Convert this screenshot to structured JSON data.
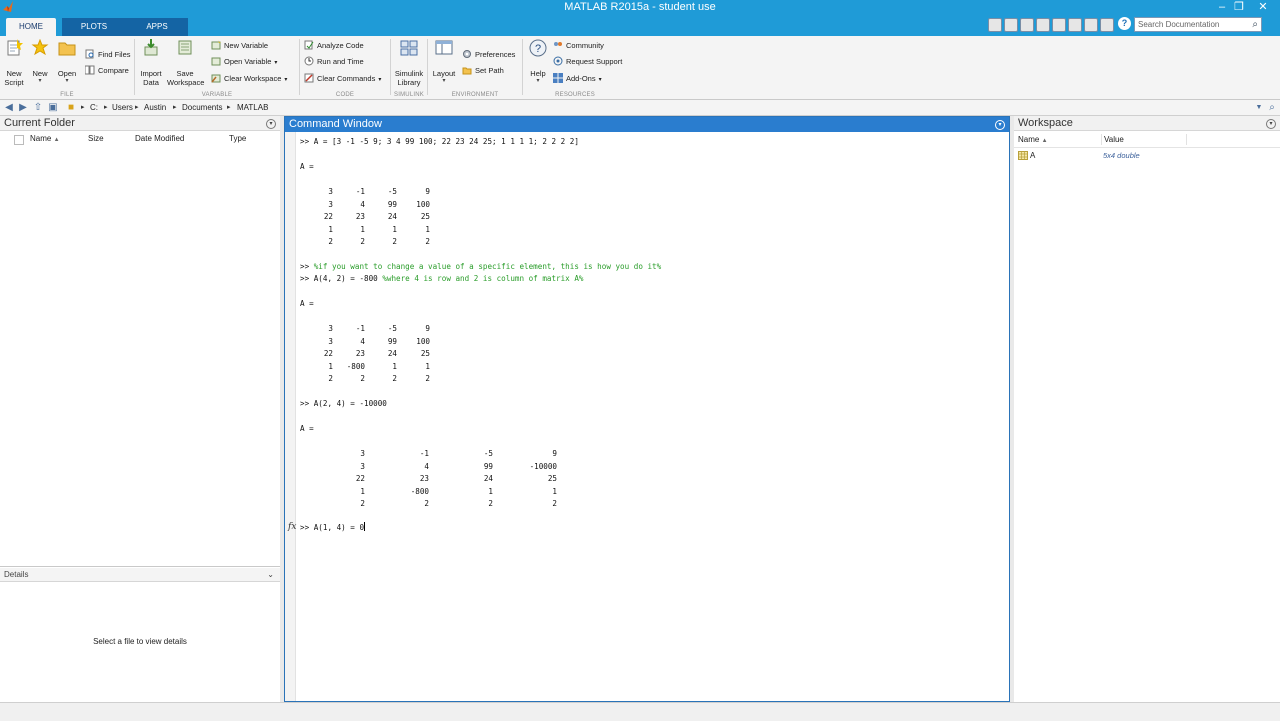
{
  "window": {
    "title": "MATLAB R2015a - student use",
    "controls": {
      "minimize": "–",
      "restore": "❐",
      "close": "✕"
    }
  },
  "tabs": [
    {
      "label": "HOME",
      "active": true
    },
    {
      "label": "PLOTS",
      "active": false
    },
    {
      "label": "APPS",
      "active": false
    }
  ],
  "search": {
    "placeholder": "Search Documentation"
  },
  "ribbon": {
    "file": {
      "group_label": "FILE",
      "new_script": "New\nScript",
      "new": "New",
      "open": "Open",
      "find_files": "Find Files",
      "compare": "Compare"
    },
    "variable": {
      "group_label": "VARIABLE",
      "import_data": "Import\nData",
      "save_workspace": "Save\nWorkspace",
      "new_variable": "New Variable",
      "open_variable": "Open Variable",
      "clear_workspace": "Clear Workspace"
    },
    "code": {
      "group_label": "CODE",
      "analyze_code": "Analyze Code",
      "run_and_time": "Run and Time",
      "clear_commands": "Clear Commands"
    },
    "simulink": {
      "group_label": "SIMULINK",
      "simulink_library": "Simulink\nLibrary"
    },
    "environment": {
      "group_label": "ENVIRONMENT",
      "layout": "Layout",
      "preferences": "Preferences",
      "set_path": "Set Path"
    },
    "resources": {
      "group_label": "RESOURCES",
      "help": "Help",
      "community": "Community",
      "request_support": "Request Support",
      "add_ons": "Add-Ons"
    }
  },
  "address_bar": {
    "crumbs": [
      "C:",
      "Users",
      "Austin",
      "Documents",
      "MATLAB"
    ]
  },
  "current_folder": {
    "title": "Current Folder",
    "columns": {
      "name": "Name",
      "sort_indicator": "▲",
      "size": "Size",
      "date_modified": "Date Modified",
      "type": "Type"
    }
  },
  "details": {
    "title": "Details",
    "empty_message": "Select a file to view details"
  },
  "command_window": {
    "title": "Command Window",
    "prompt": ">>",
    "cmd1": "A = [3 -1 -5 9; 3 4 99 100; 22 23 24 25; 1 1 1 1; 2 2 2 2]",
    "out_label": "A =",
    "matrix1": [
      [
        "3",
        "-1",
        "-5",
        "9"
      ],
      [
        "3",
        "4",
        "99",
        "100"
      ],
      [
        "22",
        "23",
        "24",
        "25"
      ],
      [
        "1",
        "1",
        "1",
        "1"
      ],
      [
        "2",
        "2",
        "2",
        "2"
      ]
    ],
    "comment_line": "%if you want to change a value of a specific element, this is how you do it%",
    "cmd2_code": "A(4, 2) = -800 ",
    "cmd2_comment": "%where 4 is row and 2 is column of matrix A%",
    "matrix2": [
      [
        "3",
        "-1",
        "-5",
        "9"
      ],
      [
        "3",
        "4",
        "99",
        "100"
      ],
      [
        "22",
        "23",
        "24",
        "25"
      ],
      [
        "1",
        "-800",
        "1",
        "1"
      ],
      [
        "2",
        "2",
        "2",
        "2"
      ]
    ],
    "cmd3": "A(2, 4) = -10000",
    "matrix3": [
      [
        "3",
        "-1",
        "-5",
        "9"
      ],
      [
        "3",
        "4",
        "99",
        "-10000"
      ],
      [
        "22",
        "23",
        "24",
        "25"
      ],
      [
        "1",
        "-800",
        "1",
        "1"
      ],
      [
        "2",
        "2",
        "2",
        "2"
      ]
    ],
    "current_input": "A(1, 4) = 0",
    "fx_label": "fx"
  },
  "workspace": {
    "title": "Workspace",
    "columns": {
      "name": "Name",
      "sort_indicator": "▲",
      "value": "Value"
    },
    "variables": [
      {
        "name": "A",
        "value": "5x4 double"
      }
    ]
  },
  "colors": {
    "title_bar": "#1f9bd7",
    "active_panel_header": "#2a7dcf",
    "comment_green": "#2a9d2a"
  }
}
